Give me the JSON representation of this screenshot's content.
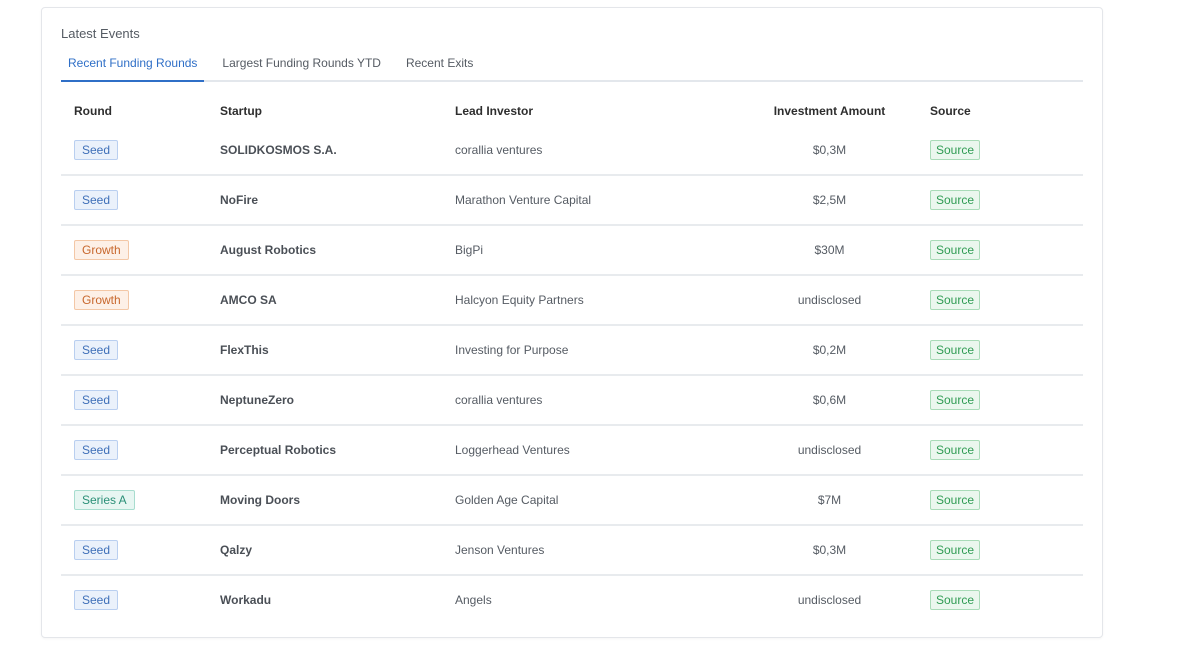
{
  "card": {
    "title": "Latest Events",
    "tabs": [
      {
        "label": "Recent Funding Rounds",
        "active": true
      },
      {
        "label": "Largest Funding Rounds YTD",
        "active": false
      },
      {
        "label": "Recent Exits",
        "active": false
      }
    ]
  },
  "table": {
    "headers": {
      "round": "Round",
      "startup": "Startup",
      "investor": "Lead Investor",
      "amount": "Investment Amount",
      "source": "Source"
    },
    "rows": [
      {
        "round": "Seed",
        "startup": "SOLIDKOSMOS S.A.",
        "investor": "corallia ventures",
        "amount": "$0,3M",
        "source": "Source"
      },
      {
        "round": "Seed",
        "startup": "NoFire",
        "investor": "Marathon Venture Capital",
        "amount": "$2,5M",
        "source": "Source"
      },
      {
        "round": "Growth",
        "startup": "August Robotics",
        "investor": "BigPi",
        "amount": "$30M",
        "source": "Source"
      },
      {
        "round": "Growth",
        "startup": "AMCO SA",
        "investor": "Halcyon Equity Partners",
        "amount": "undisclosed",
        "source": "Source"
      },
      {
        "round": "Seed",
        "startup": "FlexThis",
        "investor": "Investing for Purpose",
        "amount": "$0,2M",
        "source": "Source"
      },
      {
        "round": "Seed",
        "startup": "NeptuneZero",
        "investor": "corallia ventures",
        "amount": "$0,6M",
        "source": "Source"
      },
      {
        "round": "Seed",
        "startup": "Perceptual Robotics",
        "investor": "Loggerhead Ventures",
        "amount": "undisclosed",
        "source": "Source"
      },
      {
        "round": "Series A",
        "startup": "Moving Doors",
        "investor": "Golden Age Capital",
        "amount": "$7M",
        "source": "Source"
      },
      {
        "round": "Seed",
        "startup": "Qalzy",
        "investor": "Jenson Ventures",
        "amount": "$0,3M",
        "source": "Source"
      },
      {
        "round": "Seed",
        "startup": "Workadu",
        "investor": "Angels",
        "amount": "undisclosed",
        "source": "Source"
      }
    ]
  }
}
